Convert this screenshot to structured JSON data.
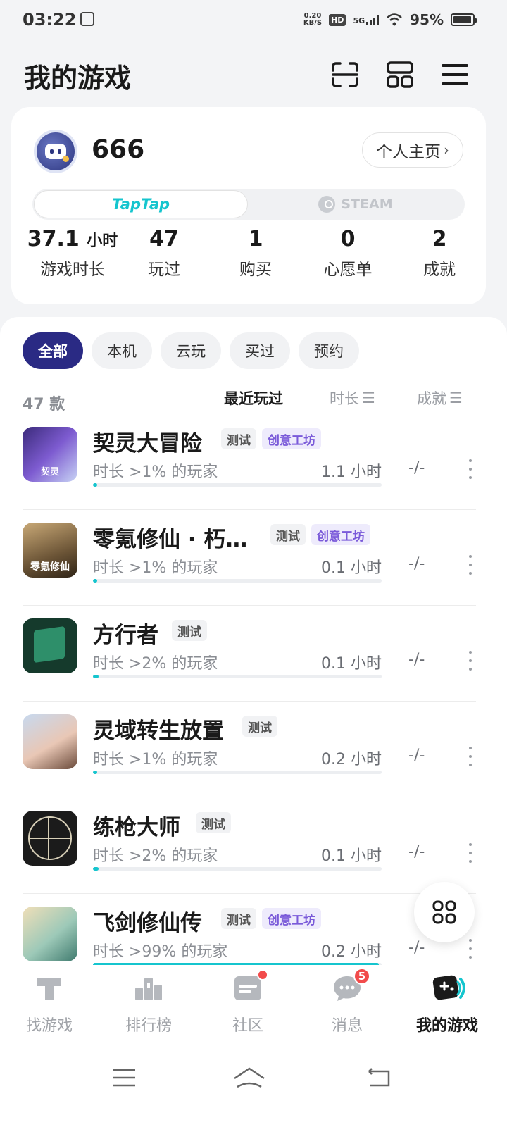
{
  "status_bar": {
    "time": "03:22",
    "net_speed_value": "0.20",
    "net_speed_unit": "KB/S",
    "hd": "HD",
    "network": "5G",
    "battery": "95%",
    "battery_level": 0.95
  },
  "header": {
    "title": "我的游戏"
  },
  "profile": {
    "username": "666",
    "profile_button": "个人主页",
    "platforms": {
      "taptap": "TapTap",
      "steam": "STEAM"
    },
    "stats": [
      {
        "value": "37.1",
        "unit": "小时",
        "label": "游戏时长"
      },
      {
        "value": "47",
        "unit": "",
        "label": "玩过"
      },
      {
        "value": "1",
        "unit": "",
        "label": "购买"
      },
      {
        "value": "0",
        "unit": "",
        "label": "心愿单"
      },
      {
        "value": "2",
        "unit": "",
        "label": "成就"
      }
    ]
  },
  "filters": [
    "全部",
    "本机",
    "云玩",
    "买过",
    "预约"
  ],
  "list_header": {
    "count": "47 款",
    "sort_recent": "最近玩过",
    "sort_duration": "时长",
    "sort_achievement": "成就"
  },
  "games": [
    {
      "name": "契灵大冒险",
      "tags": [
        "测试",
        "创意工坊"
      ],
      "percentile": "时长 >1% 的玩家",
      "hours": "1.1 小时",
      "progress": 0.01,
      "achievement": "-/-",
      "icon_text": "契灵"
    },
    {
      "name": "零氪修仙 · 朽…",
      "tags": [
        "测试",
        "创意工坊"
      ],
      "percentile": "时长 >1% 的玩家",
      "hours": "0.1 小时",
      "progress": 0.01,
      "achievement": "-/-",
      "icon_text": "零氪修仙"
    },
    {
      "name": "方行者",
      "tags": [
        "测试"
      ],
      "percentile": "时长 >2% 的玩家",
      "hours": "0.1 小时",
      "progress": 0.02,
      "achievement": "-/-",
      "icon_text": ""
    },
    {
      "name": "灵域转生放置",
      "tags": [
        "测试"
      ],
      "percentile": "时长 >1% 的玩家",
      "hours": "0.2 小时",
      "progress": 0.01,
      "achievement": "-/-",
      "icon_text": ""
    },
    {
      "name": "练枪大师",
      "tags": [
        "测试"
      ],
      "percentile": "时长 >2% 的玩家",
      "hours": "0.1 小时",
      "progress": 0.02,
      "achievement": "-/-",
      "icon_text": ""
    },
    {
      "name": "飞剑修仙传",
      "tags": [
        "测试",
        "创意工坊"
      ],
      "percentile": "时长 >99% 的玩家",
      "hours": "0.2 小时",
      "progress": 0.99,
      "achievement": "-/-",
      "icon_text": ""
    }
  ],
  "bottom_nav": [
    {
      "label": "找游戏",
      "icon": "find-game-icon"
    },
    {
      "label": "排行榜",
      "icon": "ranking-icon"
    },
    {
      "label": "社区",
      "icon": "community-icon",
      "dot": true
    },
    {
      "label": "消息",
      "icon": "message-icon",
      "badge": "5"
    },
    {
      "label": "我的游戏",
      "icon": "my-games-icon",
      "active": true
    }
  ],
  "colors": {
    "accent": "#15c5ce",
    "chip_active": "#2a2a84",
    "workshop": "#7a5ad9",
    "badge": "#f24c4c"
  }
}
